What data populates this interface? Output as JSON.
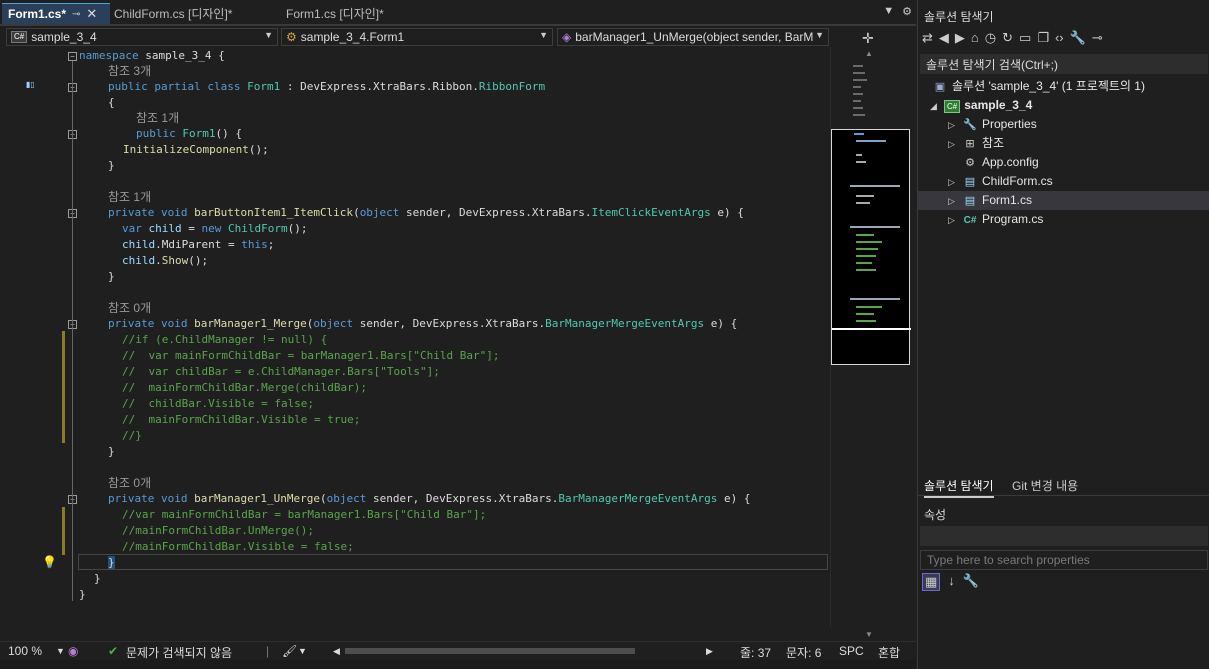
{
  "tabs": [
    {
      "label": "Form1.cs*",
      "active": true,
      "pin": "⊸",
      "close": "✕"
    },
    {
      "label": "ChildForm.cs [디자인]*",
      "active": false
    },
    {
      "label": "Form1.cs [디자인]*",
      "active": false
    }
  ],
  "nav": {
    "project": "sample_3_4",
    "class": "sample_3_4.Form1",
    "member": "barManager1_UnMerge(object sender, BarM"
  },
  "code": {
    "l1": {
      "kw": "namespace",
      "rest": " sample_3_4 {"
    },
    "ref3": "참조 3개",
    "l2": {
      "a": "public",
      "b": "partial",
      "c": "class",
      "d": "Form1",
      "e": " : DevExpress.XtraBars.Ribbon.",
      "f": "RibbonForm"
    },
    "l3": "{",
    "ref1a": "참조 1개",
    "l4": {
      "a": "public",
      "b": "Form1",
      "c": "() {"
    },
    "l5": {
      "a": "InitializeComponent",
      "b": "();"
    },
    "l6": "}",
    "ref1b": "참조 1개",
    "l7": {
      "a": "private",
      "b": "void",
      "c": "barButtonItem1_ItemClick",
      "d": "(",
      "e": "object",
      "f": " sender, DevExpress.XtraBars.",
      "g": "ItemClickEventArgs",
      "h": " e) {"
    },
    "l8": {
      "a": "var",
      "b": "child",
      "c": " = ",
      "d": "new",
      "e": "ChildForm",
      "f": "();"
    },
    "l9": {
      "a": "child",
      "b": ".MdiParent = ",
      "c": "this",
      "d": ";"
    },
    "l10": {
      "a": "child",
      "b": ".",
      "c": "Show",
      "d": "();"
    },
    "l11": "}",
    "ref0a": "참조 0개",
    "l12": {
      "a": "private",
      "b": "void",
      "c": "barManager1_Merge",
      "d": "(",
      "e": "object",
      "f": " sender, DevExpress.XtraBars.",
      "g": "BarManagerMergeEventArgs",
      "h": " e) {"
    },
    "c1": "//if (e.ChildManager != null) {",
    "c2": "//  var mainFormChildBar = barManager1.Bars[\"Child Bar\"];",
    "c3": "//  var childBar = e.ChildManager.Bars[\"Tools\"];",
    "c4": "//  mainFormChildBar.Merge(childBar);",
    "c5": "//  childBar.Visible = false;",
    "c6": "//  mainFormChildBar.Visible = true;",
    "c7": "//}",
    "l13": "}",
    "ref0b": "참조 0개",
    "l14": {
      "a": "private",
      "b": "void",
      "c": "barManager1_UnMerge",
      "d": "(",
      "e": "object",
      "f": " sender, DevExpress.XtraBars.",
      "g": "BarManagerMergeEventArgs",
      "h": " e) {"
    },
    "c8": "//var mainFormChildBar = barManager1.Bars[\"Child Bar\"];",
    "c9": "//mainFormChildBar.UnMerge();",
    "c10": "//mainFormChildBar.Visible = false;",
    "l15": "}",
    "l16": "}",
    "l17": "}"
  },
  "status": {
    "zoom": "100 %",
    "issues": "문제가 검색되지 않음",
    "line": "줄: 37",
    "col": "문자: 6",
    "spc": "SPC",
    "eol": "혼합"
  },
  "solution_explorer": {
    "title": "솔루션 탐색기",
    "search": "솔루션 탐색기 검색(Ctrl+;)",
    "solution": "솔루션 'sample_3_4' (1 프로젝트의 1)",
    "project": "sample_3_4",
    "project_badge": "C#",
    "items": [
      "Properties",
      "참조",
      "App.config",
      "ChildForm.cs",
      "Form1.cs",
      "Program.cs"
    ],
    "csharp_icon": "C#"
  },
  "bottom_tabs": [
    "솔루션 탐색기",
    "Git 변경 내용"
  ],
  "properties": {
    "title": "속성",
    "search_placeholder": "Type here to search properties"
  },
  "colors": {
    "keyword": "#569cd6",
    "type": "#4ec9b0",
    "method": "#dcdcaa",
    "comment": "#57a64a",
    "active_tab": "#2a3f5a"
  }
}
